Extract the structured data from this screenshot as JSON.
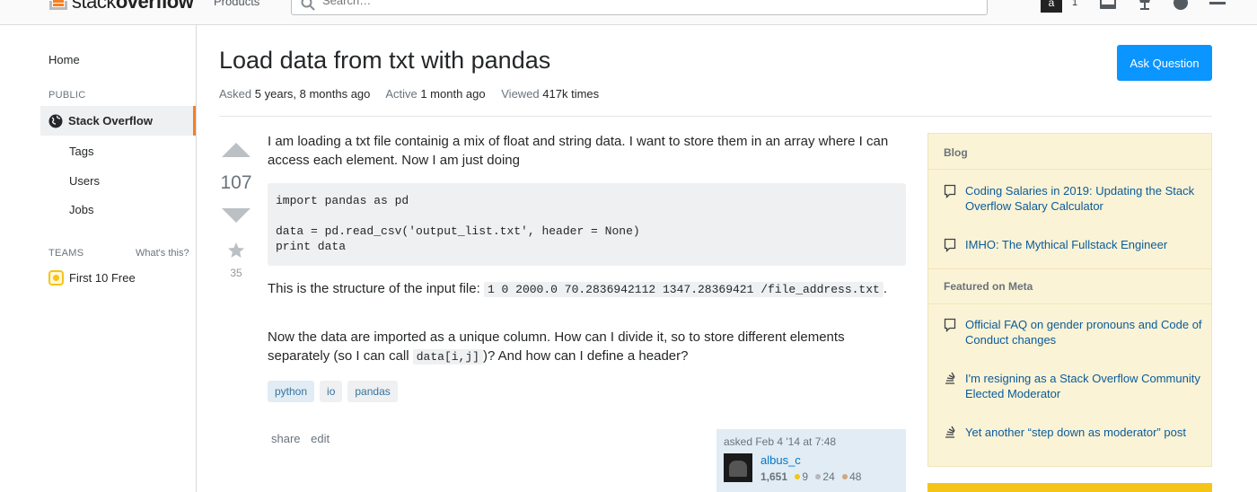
{
  "topbar": {
    "logo_plain": "stack",
    "logo_bold": "overflow",
    "products_label": "Products",
    "search_placeholder": "Search…",
    "avatar_letter": "a",
    "reputation": "1",
    "icons": [
      "inbox-icon",
      "achievements-icon",
      "help-icon",
      "site-switcher-icon"
    ]
  },
  "sidebar": {
    "home": "Home",
    "public_label": "PUBLIC",
    "stack_overflow": "Stack Overflow",
    "tags": "Tags",
    "users": "Users",
    "jobs": "Jobs",
    "teams_label": "TEAMS",
    "whats_this": "What's this?",
    "first_free": "First 10 Free"
  },
  "question": {
    "title": "Load data from txt with pandas",
    "ask_button": "Ask Question",
    "asked_label": "Asked",
    "asked_value": "5 years, 8 months ago",
    "active_label": "Active",
    "active_value": "1 month ago",
    "viewed_label": "Viewed",
    "viewed_value": "417k times",
    "votes": "107",
    "favorites": "35",
    "body_p1": "I am loading a txt file containig a mix of float and string data. I want to store them in an array where I can access each element. Now I am just doing",
    "code": "import pandas as pd\n\ndata = pd.read_csv('output_list.txt', header = None)\nprint data",
    "body_p2_prefix": "This is the structure of the input file:",
    "body_p2_code": "1 0 2000.0 70.2836942112 1347.28369421 /file_address.txt",
    "body_p2_suffix": ".",
    "body_p3_prefix": "Now the data are imported as a unique column. How can I divide it, so to store different elements separately (so I can call",
    "body_p3_code": "data[i,j]",
    "body_p3_suffix": ")? And how can I define a header?",
    "tags": [
      "python",
      "io",
      "pandas"
    ],
    "share": "share",
    "edit": "edit"
  },
  "user_card": {
    "asked": "asked Feb 4 '14 at 7:48",
    "name": "albus_c",
    "reputation": "1,651",
    "gold": "9",
    "silver": "24",
    "bronze": "48",
    "gold_color": "#f4c518",
    "silver_color": "#b4b8bc",
    "bronze_color": "#d1a684"
  },
  "right_sidebar": {
    "blog_heading": "Blog",
    "blog_items": [
      "Coding Salaries in 2019: Updating the Stack Overflow Salary Calculator",
      "IMHO: The Mythical Fullstack Engineer"
    ],
    "meta_heading": "Featured on Meta",
    "meta_items": [
      "Official FAQ on gender pronouns and Code of Conduct changes",
      "I'm resigning as a Stack Overflow Community Elected Moderator",
      "Yet another “step down as moderator” post"
    ]
  },
  "colors": {
    "accent_orange": "#f48024",
    "button_blue": "#0a95ff",
    "link_blue": "#0a5b9b",
    "widget_yellow": "#fbf3d5"
  }
}
